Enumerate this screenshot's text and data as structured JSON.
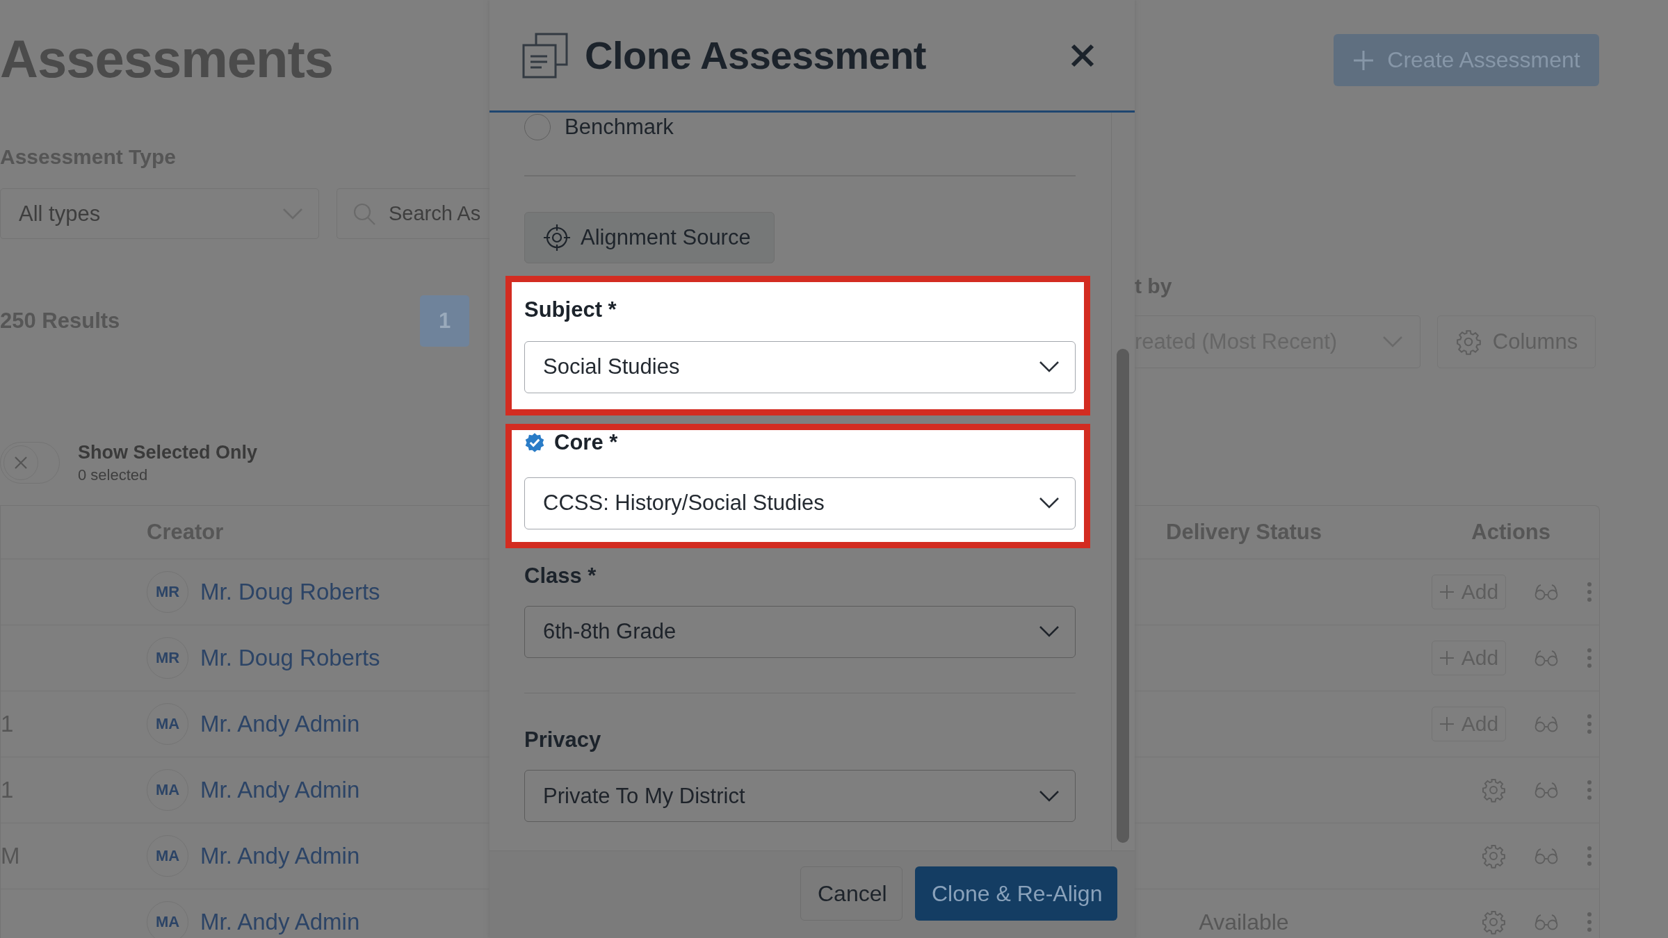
{
  "page": {
    "title": "Assessments",
    "type_filter": {
      "label": "Assessment Type",
      "value": "All types"
    },
    "search": {
      "placeholder": "Search As"
    },
    "results": "250 Results",
    "pagination": [
      {
        "label": "1",
        "selected": true
      }
    ],
    "create_button": "Create Assessment",
    "sort": {
      "label": "t by",
      "value": "reated (Most Recent)"
    },
    "columns_button": "Columns",
    "toggle": {
      "label": "Show Selected Only",
      "count": "0 selected",
      "on": false
    },
    "table": {
      "columns": [
        "Creator",
        "Delivery Status",
        "Actions"
      ],
      "rows": [
        {
          "initials": "MR",
          "creator": "Mr. Doug Roberts",
          "action": {
            "kind": "add",
            "label": "Add"
          }
        },
        {
          "initials": "MR",
          "creator": "Mr. Doug Roberts",
          "action": {
            "kind": "add",
            "label": "Add"
          }
        },
        {
          "column_1": "1",
          "initials": "MA",
          "creator": "Mr. Andy Admin",
          "action": {
            "kind": "add",
            "label": "Add"
          }
        },
        {
          "column_1": "1",
          "initials": "MA",
          "creator": "Mr. Andy Admin",
          "action": {
            "kind": "settings"
          }
        },
        {
          "column_1": "M",
          "initials": "MA",
          "creator": "Mr. Andy Admin",
          "action": {
            "kind": "settings"
          }
        },
        {
          "initials": "MA",
          "creator": "Mr. Andy Admin",
          "delivery_status": "Available",
          "action": {
            "kind": "settings"
          }
        }
      ]
    }
  },
  "modal": {
    "title": "Clone Assessment",
    "type_options": [
      {
        "label": "Benchmark",
        "selected": false
      }
    ],
    "alignment_button": "Alignment Source",
    "fields": [
      {
        "label": "Subject *",
        "value": "Social Studies",
        "highlighted": true,
        "verified": false,
        "divider_after": false
      },
      {
        "label": "Core *",
        "value": "CCSS: History/Social Studies",
        "highlighted": true,
        "verified": true,
        "divider_after": false
      },
      {
        "label": "Class *",
        "value": "6th-8th Grade",
        "highlighted": false,
        "verified": false,
        "divider_after": true
      },
      {
        "label": "Privacy",
        "value": "Private To My District",
        "highlighted": false,
        "verified": false,
        "divider_after": false
      }
    ],
    "buttons": [
      {
        "kind": "secondary",
        "label": "Cancel"
      },
      {
        "kind": "primary",
        "label": "Clone & Re-Align"
      }
    ]
  }
}
